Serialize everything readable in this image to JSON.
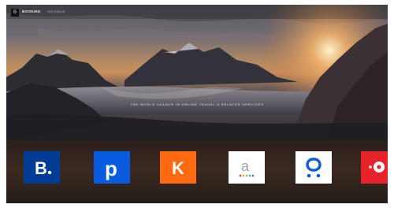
{
  "header": {
    "logo_glyph": "B",
    "brand_name": "BOOKING",
    "brand_sub": "HOLDINGS"
  },
  "hero": {
    "tagline": "THE WORLD LEADER IN ONLINE TRAVEL & RELATED SERVICES"
  },
  "brands": [
    {
      "glyph": "B.",
      "bg": "#003b95",
      "fg": "#ffffff",
      "icon": "booking-icon",
      "name": "",
      "desc": ""
    },
    {
      "glyph": "p",
      "bg": "#0a5cde",
      "fg": "#ffffff",
      "icon": "priceline-icon",
      "name": "",
      "desc": ""
    },
    {
      "glyph": "K",
      "bg": "#ff690f",
      "fg": "#ffffff",
      "icon": "kayak-icon",
      "name": "",
      "desc": ""
    },
    {
      "glyph": "a",
      "bg": "#ffffff",
      "fg": "#9aa3ad",
      "icon": "agoda-icon",
      "name": "",
      "desc": ""
    },
    {
      "glyph": "o",
      "bg": "#ffffff",
      "fg": "#0e5fd8",
      "icon": "rentalcars-icon",
      "name": "",
      "desc": ""
    },
    {
      "glyph": "•",
      "bg": "#e8222a",
      "fg": "#ffffff",
      "icon": "opentable-icon",
      "name": "",
      "desc": ""
    }
  ]
}
